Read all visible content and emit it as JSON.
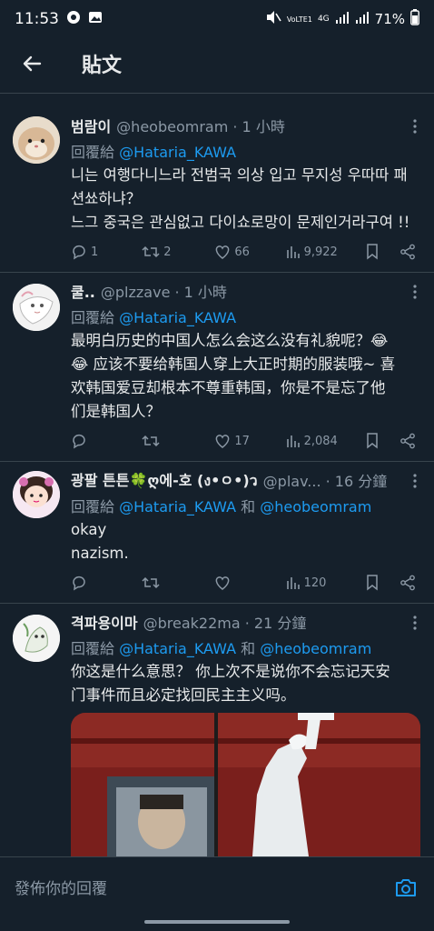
{
  "status_bar": {
    "time": "11:53",
    "network": "VoLTE1",
    "network_gen": "4G",
    "battery": "71%"
  },
  "header": {
    "title": "貼文"
  },
  "tweets": [
    {
      "name": "범람이",
      "handle": "@heobeomram · 1 小時",
      "reply_prefix": "回覆給 ",
      "reply_to": "@Hataria_KAWA",
      "reply_extra": "",
      "text": "니는 여행다니느라 전범국 의상 입고 무지성 우따따 패\n션쑈하냐？\n느그 중국은 관심없고 다이쇼로망이 문제인거라구여 !!",
      "replies": "1",
      "retweets": "2",
      "likes": "66",
      "views": "9,922"
    },
    {
      "name": "쿨..",
      "handle": "@plzzave · 1 小時",
      "reply_prefix": "回覆給 ",
      "reply_to": "@Hataria_KAWA",
      "reply_extra": "",
      "text": "最明白历史的中国人怎么会这么没有礼貌呢？😂\n😂 应该不要给韩国人穿上大正时期的服装哦~ 喜\n欢韩国爱豆却根本不尊重韩国，你是不是忘了他\n们是韩国人？",
      "replies": "",
      "retweets": "",
      "likes": "17",
      "views": "2,084"
    },
    {
      "name": "광팔 튼튼🍀ღ에-호 (ง•ㅇ•)ว",
      "handle": "@plav... · 16 分鐘",
      "reply_prefix": "回覆給 ",
      "reply_to": "@Hataria_KAWA",
      "reply_extra": " 和 ",
      "reply_to2": "@heobeomram",
      "text": "okay\nnazism.",
      "replies": "",
      "retweets": "",
      "likes": "",
      "views": "120"
    },
    {
      "name": "격파용이마",
      "handle": "@break22ma · 21 分鐘",
      "reply_prefix": "回覆給 ",
      "reply_to": "@Hataria_KAWA",
      "reply_extra": " 和 ",
      "reply_to2": "@heobeomram",
      "text": "你这是什么意思？ 你上次不是说你不会忘记天安\n门事件而且必定找回民主主义吗。"
    }
  ],
  "composer": {
    "placeholder": "發佈你的回覆"
  },
  "colors": {
    "background": "#15202b",
    "accent": "#1d9bf0",
    "muted": "#8b98a5",
    "divider": "#38444d"
  }
}
